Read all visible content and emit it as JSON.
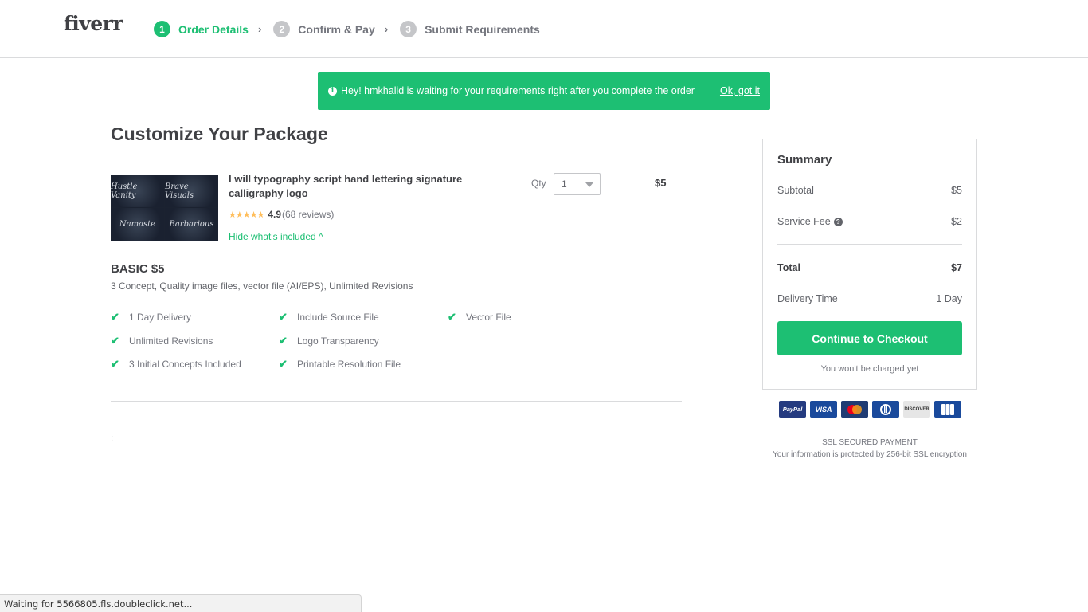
{
  "header": {
    "logo": "fiverr",
    "steps": [
      {
        "num": "1",
        "label": "Order Details",
        "state": "active"
      },
      {
        "num": "2",
        "label": "Confirm & Pay",
        "state": "inactive"
      },
      {
        "num": "3",
        "label": "Submit Requirements",
        "state": "inactive"
      }
    ],
    "separator_icon": "chevron-right-icon",
    "separator_glyph": "›"
  },
  "banner": {
    "icon": "info-icon",
    "icon_glyph": "i",
    "message": "Hey! hmkhalid is waiting for your requirements right after you complete the order",
    "dismiss_label": "Ok, got it"
  },
  "page_title": "Customize Your Package",
  "gig": {
    "image_labels": [
      "Hustle Vanity",
      "Brave Visuals",
      "Namaste",
      "Barbarious"
    ],
    "title": "I will typography script hand lettering signature calligraphy logo",
    "stars_glyph": "★★★★★",
    "rating": "4.9",
    "reviews": "(68 reviews)",
    "toggle_label": "Hide what's included ^",
    "qty_label": "Qty",
    "qty_value": "1",
    "price": "$5"
  },
  "package": {
    "name": "BASIC $5",
    "description": "3 Concept, Quality image files, vector file (AI/EPS), Unlimited Revisions",
    "check_glyph": "✔",
    "features": [
      "1 Day Delivery",
      "Unlimited Revisions",
      "3 Initial Concepts Included",
      "Include Source File",
      "Logo Transparency",
      "Printable Resolution File",
      "Vector File"
    ]
  },
  "stray_text": ";",
  "summary": {
    "title": "Summary",
    "subtotal_label": "Subtotal",
    "subtotal_value": "$5",
    "fee_label": "Service Fee",
    "fee_help_glyph": "?",
    "fee_value": "$2",
    "total_label": "Total",
    "total_value": "$7",
    "delivery_label": "Delivery Time",
    "delivery_value": "1 Day",
    "checkout_button": "Continue to Checkout",
    "no_charge_note": "You won't be charged yet"
  },
  "payment_methods": [
    {
      "name": "PayPal",
      "color": "#253b80"
    },
    {
      "name": "VISA",
      "color": "#1a4a9c"
    },
    {
      "name": "MasterCard",
      "color": "#1f3b73"
    },
    {
      "name": "Diners",
      "color": "#1a4a9c"
    },
    {
      "name": "DISCOVER",
      "color": "#e6e6e6"
    },
    {
      "name": "JCB",
      "color": "#1a4a9c"
    }
  ],
  "ssl": {
    "title": "SSL SECURED PAYMENT",
    "note": "Your information is protected by 256-bit SSL encryption"
  },
  "browser_status": "Waiting for 5566805.fls.doubleclick.net..."
}
